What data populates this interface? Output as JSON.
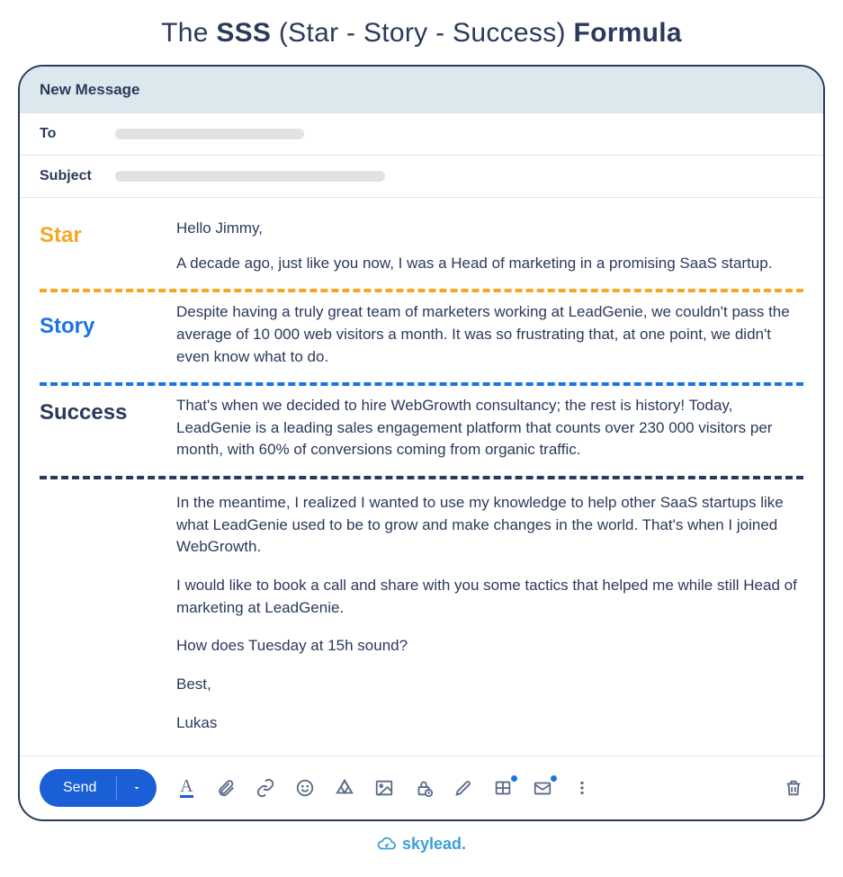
{
  "page_title": {
    "prefix": "The ",
    "sss": "SSS",
    "middle": " (Star - Story - Success) ",
    "suffix": "Formula"
  },
  "compose": {
    "new_message": "New Message",
    "to_label": "To",
    "subject_label": "Subject"
  },
  "sections": {
    "star": {
      "label": "Star",
      "greeting": "Hello Jimmy,",
      "text": "A decade ago, just like you now, I was a Head of marketing in a promising SaaS startup."
    },
    "story": {
      "label": "Story",
      "text": "Despite having a truly great team of marketers working at LeadGenie, we couldn't pass the average of 10 000 web visitors a month. It was so frustrating that, at one point, we didn't even know what to do."
    },
    "success": {
      "label": "Success",
      "text": "That's when we decided to hire WebGrowth consultancy; the rest is history! Today, LeadGenie is a leading sales engagement platform that counts over 230 000 visitors per month, with 60% of conversions coming from organic traffic."
    }
  },
  "rest": {
    "p1": "In the meantime, I realized I wanted to use my knowledge to help other SaaS startups like what LeadGenie used to be to grow and make changes in the world. That's when I joined WebGrowth.",
    "p2": "I would like to book a call and share with you some tactics that helped me while still Head of marketing at LeadGenie.",
    "p3": "How does Tuesday at 15h sound?",
    "closing": "Best,",
    "signature": "Lukas"
  },
  "toolbar": {
    "send": "Send"
  },
  "brand": "skylead."
}
